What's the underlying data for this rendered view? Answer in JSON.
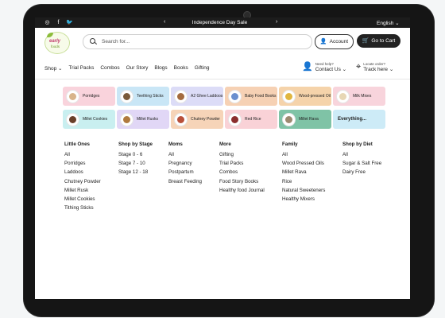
{
  "topbar": {
    "social": [
      "instagram-icon",
      "facebook-icon",
      "twitter-icon"
    ],
    "sale": "Independence Day Sale",
    "language": "English"
  },
  "header": {
    "logo_text": "early",
    "logo_text2": "foods",
    "search_placeholder": "Search for...",
    "account_label": "Account",
    "cart_label": "Go to Cart"
  },
  "nav": {
    "items": [
      "Shop",
      "Trial Packs",
      "Combos",
      "Our Story",
      "Blogs",
      "Books",
      "Gifting"
    ],
    "help_small": "Need help?",
    "help_label": "Contact Us",
    "locate_small": "Locate order?",
    "locate_label": "Track here"
  },
  "categories": [
    {
      "label": "Porridges",
      "bg": "#f9d3dc",
      "dot": "#d8b48a"
    },
    {
      "label": "Teething Sticks",
      "bg": "#c9e6f6",
      "dot": "#7a5a3a"
    },
    {
      "label": "A2 Ghee Laddoos",
      "bg": "#dcdcf7",
      "dot": "#a46b3e"
    },
    {
      "label": "Baby Food Books",
      "bg": "#f6d1b4",
      "dot": "#6a8fcf"
    },
    {
      "label": "Wood-pressed Oil",
      "bg": "#f5d3aa",
      "dot": "#e0b640"
    },
    {
      "label": "Milk Mixes",
      "bg": "#f8d4dc",
      "dot": "#e7d7b5"
    },
    {
      "label": "Millet Cookies",
      "bg": "#c9eff0",
      "dot": "#6a3f2a"
    },
    {
      "label": "Millet Rusks",
      "bg": "#e1d7f6",
      "dot": "#b07a3e"
    },
    {
      "label": "Chutney Powder",
      "bg": "#f6d4b8",
      "dot": "#b8503a"
    },
    {
      "label": "Red Rice",
      "bg": "#f9d2d7",
      "dot": "#8b2e2e"
    },
    {
      "label": "Millet Rava",
      "bg": "#7fc3a6",
      "dot": "#9d8a70"
    },
    {
      "label": "Everything...",
      "bg": "#cdebf7",
      "dot": ""
    }
  ],
  "menu": {
    "little_ones": {
      "head": "Little Ones",
      "items": [
        "All",
        "Porridges",
        "Laddoos",
        "Chutney Powder",
        "Millet Rusk",
        "Millet Cookies",
        "Tithing Sticks"
      ]
    },
    "by_stage": {
      "head": "Shop by Stage",
      "items": [
        "Stage 0 - 6",
        "Stage 7 - 10",
        "Stage 12 - 18"
      ]
    },
    "moms": {
      "head": "Moms",
      "items": [
        "All",
        "Pregnancy",
        "Postpartum",
        "Breast Feeding"
      ]
    },
    "more": {
      "head": "More",
      "items": [
        "Gifting",
        "Trial Packs",
        "Combos",
        "Food Story Books",
        "Healthy food Journal"
      ]
    },
    "family": {
      "head": "Family",
      "items": [
        "All",
        "Wood Pressed Oils",
        "Millet Rava",
        "Rice",
        "Natural Sweeteners",
        "Healthy Mixers"
      ]
    },
    "by_diet": {
      "head": "Shop by Diet",
      "items": [
        "All",
        "Sugar & Salt Free",
        "Dairy Free"
      ]
    }
  }
}
